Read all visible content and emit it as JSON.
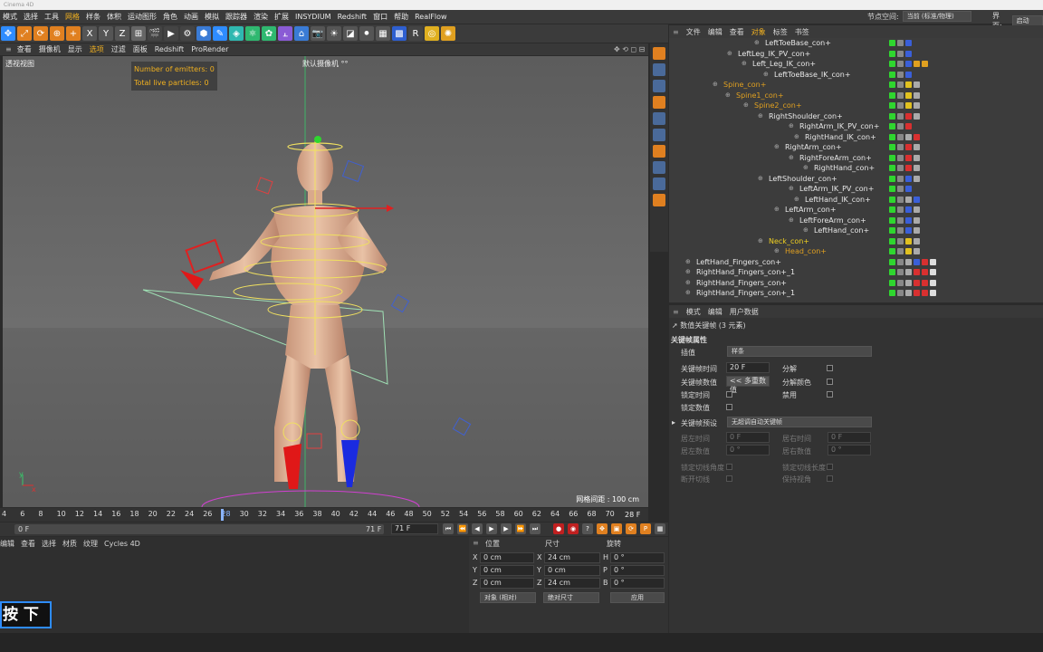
{
  "titlebar": {
    "text": "Cinema 4D"
  },
  "menubar": {
    "items": [
      "模式",
      "选择",
      "工具",
      "网格",
      "样条",
      "体积",
      "运动图形",
      "角色",
      "动画",
      "模拟",
      "跟踪器",
      "渲染",
      "扩展",
      "INSYDIUM",
      "Redshift",
      "窗口",
      "帮助",
      "RealFlow"
    ],
    "highlight_index": 3,
    "node_space_label": "节点空间:",
    "node_space_value": "当前 (标准/物理)",
    "interface_label": "界面:",
    "interface_value": "启动 (用"
  },
  "toolbar": {
    "icons": [
      "move-icon",
      "scale-icon",
      "rotate-icon",
      "transform-icon",
      "add-icon",
      "x-axis-icon",
      "y-axis-icon",
      "z-axis-icon",
      "coord-icon",
      "render-view-icon",
      "render-icon",
      "render-settings-icon",
      "cube-icon",
      "pen-icon",
      "subdivide-icon",
      "cloner-icon",
      "effector-icon",
      "deformer-icon",
      "scene-icon",
      "camera-icon",
      "light-icon",
      "tag-icon",
      "xpresso-icon",
      "grid-icon",
      "qr-icon",
      "redshift-icon",
      "target-icon",
      "sun-icon"
    ]
  },
  "viewport": {
    "menu": [
      "查看",
      "摄像机",
      "显示",
      "选项",
      "过滤",
      "面板",
      "Redshift",
      "ProRender"
    ],
    "highlight_index": 3,
    "label": "透视视图",
    "camera": "默认摄像机 °°",
    "hud_emitters": "Number of emitters: 0",
    "hud_particles": "Total live particles: 0",
    "grid_info": "网格间距 : 100 cm"
  },
  "timeline": {
    "ticks": [
      "4",
      "6",
      "8",
      "10",
      "12",
      "14",
      "16",
      "18",
      "20",
      "22",
      "24",
      "26",
      "28",
      "30",
      "32",
      "34",
      "36",
      "38",
      "40",
      "42",
      "44",
      "46",
      "48",
      "50",
      "52",
      "54",
      "56",
      "58",
      "60",
      "62",
      "64",
      "66",
      "68",
      "70"
    ],
    "current_frame": "28",
    "end_frame": "28 F"
  },
  "playbar": {
    "start": "0 F",
    "range_end": "71 F",
    "max": "71 F"
  },
  "material": {
    "menu": [
      "编辑",
      "查看",
      "选择",
      "材质",
      "纹理",
      "Cycles 4D"
    ]
  },
  "coords": {
    "headers": [
      "位置",
      "尺寸",
      "旋转"
    ],
    "rows": [
      {
        "a": "X",
        "pos": "0 cm",
        "b": "X",
        "size": "24 cm",
        "c": "H",
        "rot": "0 °"
      },
      {
        "a": "Y",
        "pos": "0 cm",
        "b": "Y",
        "size": "0 cm",
        "c": "P",
        "rot": "0 °"
      },
      {
        "a": "Z",
        "pos": "0 cm",
        "b": "Z",
        "size": "24 cm",
        "c": "B",
        "rot": "0 °"
      }
    ],
    "mode": "对象 (相对)",
    "size_mode": "绝对尺寸",
    "apply": "应用"
  },
  "objects": {
    "menu": [
      "文件",
      "编辑",
      "查看",
      "对象",
      "标签",
      "书签"
    ],
    "highlight_index": 3,
    "rows": [
      {
        "name": "LeftToeBase_con+",
        "indent": 106,
        "color": "#e8e8e8",
        "tags": [
          "#2fd62f",
          "#888",
          "#3a5fd8"
        ]
      },
      {
        "name": "LeftLeg_IK_PV_con+",
        "indent": 76,
        "color": "#e8e8e8",
        "tags": [
          "#2fd62f",
          "#888",
          "#3a5fd8"
        ]
      },
      {
        "name": "Left_Leg_IK_con+",
        "indent": 92,
        "color": "#e8e8e8",
        "tags": [
          "#2fd62f",
          "#888",
          "#3a5fd8",
          "#e0a020",
          "#e0a020"
        ]
      },
      {
        "name": "LeftToeBase_IK_con+",
        "indent": 116,
        "color": "#e8e8e8",
        "tags": [
          "#2fd62f",
          "#888",
          "#3a5fd8"
        ]
      },
      {
        "name": "Spine_con+",
        "indent": 60,
        "color": "#e0a020",
        "tags": [
          "#2fd62f",
          "#888",
          "#e0c020",
          "#aaa"
        ]
      },
      {
        "name": "Spine1_con+",
        "indent": 74,
        "color": "#e0a020",
        "tags": [
          "#2fd62f",
          "#888",
          "#e0c020",
          "#aaa"
        ]
      },
      {
        "name": "Spine2_con+",
        "indent": 94,
        "color": "#e0a020",
        "tags": [
          "#2fd62f",
          "#888",
          "#e0c020",
          "#aaa"
        ]
      },
      {
        "name": "RightShoulder_con+",
        "indent": 110,
        "color": "#e8e8e8",
        "tags": [
          "#2fd62f",
          "#888",
          "#d83030",
          "#aaa"
        ]
      },
      {
        "name": "RightArm_IK_PV_con+",
        "indent": 144,
        "color": "#e8e8e8",
        "tags": [
          "#2fd62f",
          "#888",
          "#d83030"
        ]
      },
      {
        "name": "RightHand_IK_con+",
        "indent": 150,
        "color": "#e8e8e8",
        "tags": [
          "#2fd62f",
          "#888",
          "#aaa",
          "#d83030"
        ]
      },
      {
        "name": "RightArm_con+",
        "indent": 128,
        "color": "#e8e8e8",
        "tags": [
          "#2fd62f",
          "#888",
          "#d83030",
          "#aaa"
        ]
      },
      {
        "name": "RightForeArm_con+",
        "indent": 144,
        "color": "#e8e8e8",
        "tags": [
          "#2fd62f",
          "#888",
          "#d83030",
          "#aaa"
        ]
      },
      {
        "name": "RightHand_con+",
        "indent": 160,
        "color": "#e8e8e8",
        "tags": [
          "#2fd62f",
          "#888",
          "#d83030",
          "#aaa"
        ]
      },
      {
        "name": "LeftShoulder_con+",
        "indent": 110,
        "color": "#e8e8e8",
        "tags": [
          "#2fd62f",
          "#888",
          "#3a5fd8",
          "#aaa"
        ]
      },
      {
        "name": "LeftArm_IK_PV_con+",
        "indent": 144,
        "color": "#e8e8e8",
        "tags": [
          "#2fd62f",
          "#888",
          "#3a5fd8"
        ]
      },
      {
        "name": "LeftHand_IK_con+",
        "indent": 150,
        "color": "#e8e8e8",
        "tags": [
          "#2fd62f",
          "#888",
          "#aaa",
          "#3a5fd8"
        ]
      },
      {
        "name": "LeftArm_con+",
        "indent": 128,
        "color": "#e8e8e8",
        "tags": [
          "#2fd62f",
          "#888",
          "#3a5fd8",
          "#aaa"
        ]
      },
      {
        "name": "LeftForeArm_con+",
        "indent": 144,
        "color": "#e8e8e8",
        "tags": [
          "#2fd62f",
          "#888",
          "#3a5fd8",
          "#aaa"
        ]
      },
      {
        "name": "LeftHand_con+",
        "indent": 160,
        "color": "#e8e8e8",
        "tags": [
          "#2fd62f",
          "#888",
          "#3a5fd8",
          "#aaa"
        ]
      },
      {
        "name": "Neck_con+",
        "indent": 110,
        "color": "#f0d020",
        "tags": [
          "#2fd62f",
          "#888",
          "#e0c020",
          "#aaa"
        ]
      },
      {
        "name": "Head_con+",
        "indent": 128,
        "color": "#e0a020",
        "tags": [
          "#2fd62f",
          "#888",
          "#e0c020",
          "#aaa"
        ]
      },
      {
        "name": "LeftHand_Fingers_con+",
        "indent": 30,
        "color": "#e8e8e8",
        "tags": [
          "#2fd62f",
          "#888",
          "#aaa",
          "#3a5fd8",
          "#d83030",
          "#ddd"
        ]
      },
      {
        "name": "RightHand_Fingers_con+_1",
        "indent": 30,
        "color": "#e8e8e8",
        "tags": [
          "#2fd62f",
          "#888",
          "#aaa",
          "#d83030",
          "#d83030",
          "#ddd"
        ]
      },
      {
        "name": "RightHand_Fingers_con+",
        "indent": 30,
        "color": "#e8e8e8",
        "tags": [
          "#2fd62f",
          "#888",
          "#aaa",
          "#d83030",
          "#d83030",
          "#ddd"
        ]
      },
      {
        "name": "RightHand_Fingers_con+_1",
        "indent": 30,
        "color": "#e8e8e8",
        "tags": [
          "#2fd62f",
          "#888",
          "#aaa",
          "#d83030",
          "#d83030",
          "#ddd"
        ]
      }
    ]
  },
  "attributes": {
    "menu": [
      "模式",
      "编辑",
      "用户数据"
    ],
    "subtitle": "数值关键帧 (3 元素)",
    "section": "关键帧属性",
    "interp_label": "插值",
    "interp_value": "样条",
    "time_label": "关键帧时间",
    "time_value": "20 F",
    "split_label": "分解",
    "value_label": "关键帧数值",
    "value_value": "<< 多重数值",
    "split_color_label": "分解颜色",
    "lock_time_label": "锁定时间",
    "mute_label": "禁用",
    "lock_value_label": "锁定数值",
    "preset_label": "关键帧预设",
    "preset_value": "无超调自动关键帧",
    "left_time_label": "居左时间",
    "left_time_value": "0 F",
    "right_time_label": "居右时间",
    "right_time_value": "0 F",
    "left_value_label": "居左数值",
    "left_value_value": "0 °",
    "right_value_label": "居右数值",
    "right_value_value": "0 °",
    "lock_tangent_angle": "锁定切线角度",
    "lock_tangent_length": "锁定切线长度",
    "break_tangent": "断开切线",
    "keep_visual": "保持视角"
  },
  "overlay": {
    "press_hint": "按 下>"
  }
}
